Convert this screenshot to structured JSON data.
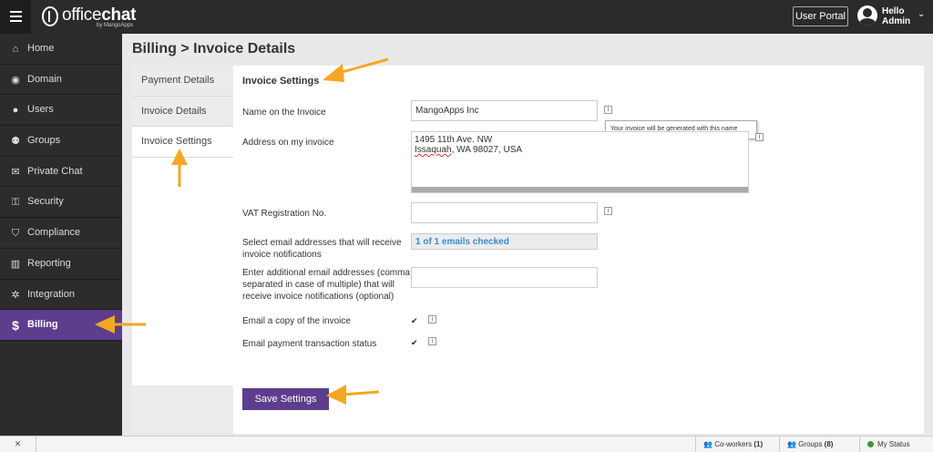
{
  "app": {
    "logo_main": "office",
    "logo_bold": "chat",
    "logo_sub": "by MangoApps",
    "user_portal_label": "User Portal",
    "hello_line1": "Hello",
    "hello_line2": "Admin",
    "caret": "⌄"
  },
  "sidebar": {
    "items": [
      {
        "label": "Home",
        "icon": "⌂"
      },
      {
        "label": "Domain",
        "icon": "◉"
      },
      {
        "label": "Users",
        "icon": "●"
      },
      {
        "label": "Groups",
        "icon": "⚉"
      },
      {
        "label": "Private Chat",
        "icon": "✉"
      },
      {
        "label": "Security",
        "icon": "⚿"
      },
      {
        "label": "Compliance",
        "icon": "⛉"
      },
      {
        "label": "Reporting",
        "icon": "▥"
      },
      {
        "label": "Integration",
        "icon": "✲"
      },
      {
        "label": "Billing",
        "icon": "$"
      }
    ],
    "active_index": 9
  },
  "breadcrumb": "Billing > Invoice Details",
  "tabs": [
    {
      "label": "Payment Details"
    },
    {
      "label": "Invoice Details"
    },
    {
      "label": "Invoice Settings"
    }
  ],
  "form": {
    "section_title": "Invoice Settings",
    "name_label": "Name on the Invoice",
    "name_value": "MangoApps Inc",
    "tooltip": "Your invoice will be generated with this name",
    "address_label": "Address on my invoice",
    "address_line1": "1495 11th Ave. NW",
    "address_line2_a": "Issaquah",
    "address_line2_b": ", WA 98027, USA",
    "vat_label": "VAT Registration No.",
    "vat_value": "",
    "select_emails_label_1": "Select email addresses that will receive",
    "select_emails_label_2": "invoice notifications",
    "emails_checked": "1 of 1 emails checked",
    "additional_label_1": "Enter additional email addresses (comma",
    "additional_label_2": "separated in case of multiple) that will",
    "additional_label_3": "receive invoice notifications (optional)",
    "additional_value": "",
    "email_copy_label": "Email a copy of the invoice",
    "email_payment_label": "Email payment transaction status",
    "info_glyph": "i",
    "check_glyph": "✔",
    "save_label": "Save Settings"
  },
  "bottom_bar": {
    "expand_glyph": "✕",
    "coworkers_label": "Co-workers",
    "coworkers_count": "(1)",
    "groups_label": "Groups",
    "groups_count": "(8)",
    "status_label": "My Status"
  },
  "colors": {
    "accent_purple": "#5c3e8c",
    "arrow_orange": "#f5a623",
    "link_blue": "#3a8bcd"
  }
}
